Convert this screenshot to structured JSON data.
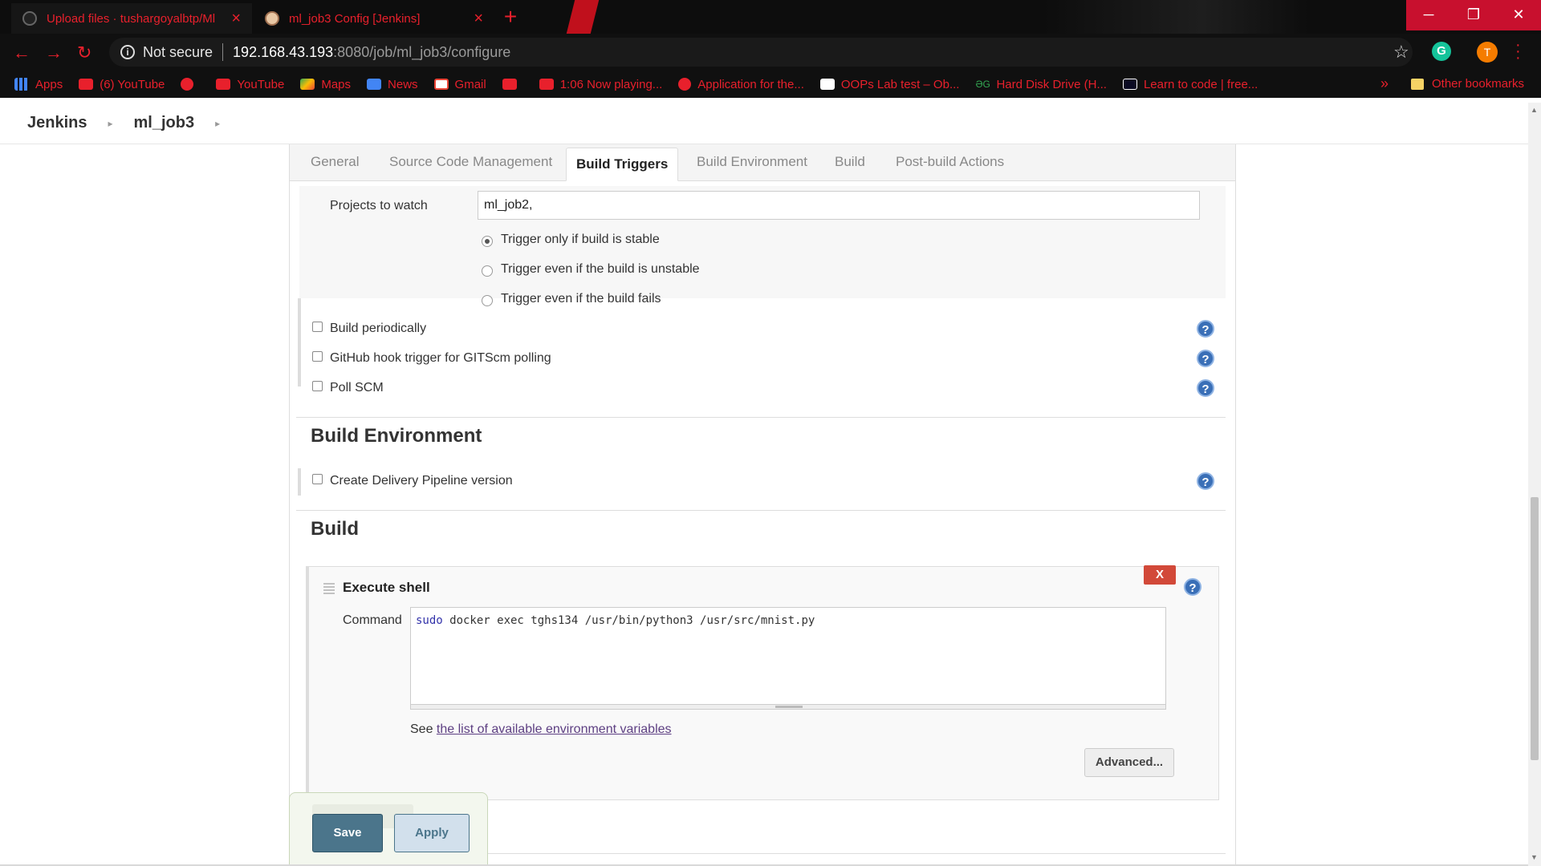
{
  "browser": {
    "tabs": [
      {
        "title": "Upload files · tushargoyalbtp/Ml",
        "close": "×"
      },
      {
        "title": "ml_job3 Config [Jenkins]",
        "close": "×"
      }
    ],
    "new_tab": "+",
    "window_controls": {
      "minimize": "─",
      "maximize": "❐",
      "close": "✕"
    },
    "nav": {
      "back": "←",
      "forward": "→",
      "reload": "↻"
    },
    "address": {
      "security_label": "Not secure",
      "host": "192.168.43.193",
      "path": ":8080/job/ml_job3/configure"
    },
    "profile_initial": "T",
    "extension_initial": "G",
    "bookmarks": [
      {
        "label": "Apps",
        "icon": "apps-grid-icon"
      },
      {
        "label": "(6) YouTube",
        "icon": "youtube-icon"
      },
      {
        "label": "",
        "icon": "globe-icon"
      },
      {
        "label": "YouTube",
        "icon": "youtube-icon"
      },
      {
        "label": "Maps",
        "icon": "maps-icon"
      },
      {
        "label": "News",
        "icon": "news-icon"
      },
      {
        "label": "Gmail",
        "icon": "gmail-icon"
      },
      {
        "label": "",
        "icon": "youtube-icon"
      },
      {
        "label": "1:06 Now playing...",
        "icon": "youtube-icon"
      },
      {
        "label": "Application for the...",
        "icon": "globe-icon"
      },
      {
        "label": "OOPs Lab test – Ob...",
        "icon": "blackboard-icon"
      },
      {
        "label": "Hard Disk Drive (H...",
        "icon": "gg-icon"
      },
      {
        "label": "Learn to code | free...",
        "icon": "freecodecamp-icon"
      }
    ],
    "bookmarks_more": "»",
    "other_bookmarks": "Other bookmarks"
  },
  "jenkins": {
    "breadcrumbs": [
      "Jenkins",
      "ml_job3"
    ],
    "tabs": [
      {
        "label": "General",
        "active": false
      },
      {
        "label": "Source Code Management",
        "active": false
      },
      {
        "label": "Build Triggers",
        "active": true
      },
      {
        "label": "Build Environment",
        "active": false
      },
      {
        "label": "Build",
        "active": false
      },
      {
        "label": "Post-build Actions",
        "active": false
      }
    ],
    "triggers": {
      "projects_to_watch_label": "Projects to watch",
      "projects_to_watch_value": "ml_job2,",
      "radio_options": [
        {
          "label": "Trigger only if build is stable",
          "checked": true
        },
        {
          "label": "Trigger even if the build is unstable",
          "checked": false
        },
        {
          "label": "Trigger even if the build fails",
          "checked": false
        }
      ],
      "checkboxes": [
        {
          "label": "Build periodically",
          "checked": false
        },
        {
          "label": "GitHub hook trigger for GITScm polling",
          "checked": false
        },
        {
          "label": "Poll SCM",
          "checked": false
        }
      ]
    },
    "build_environment": {
      "title": "Build Environment",
      "checkboxes": [
        {
          "label": "Create Delivery Pipeline version",
          "checked": false
        }
      ]
    },
    "build": {
      "title": "Build",
      "step": {
        "title": "Execute shell",
        "delete_label": "X",
        "command_label": "Command",
        "command_keyword": "sudo",
        "command_rest": " docker exec tghs134 /usr/bin/python3 /usr/src/mnist.py",
        "see_text": "See ",
        "env_link": "the list of available environment variables",
        "advanced_label": "Advanced..."
      }
    },
    "help_glyph": "?",
    "actions": {
      "save": "Save",
      "apply": "Apply"
    }
  }
}
